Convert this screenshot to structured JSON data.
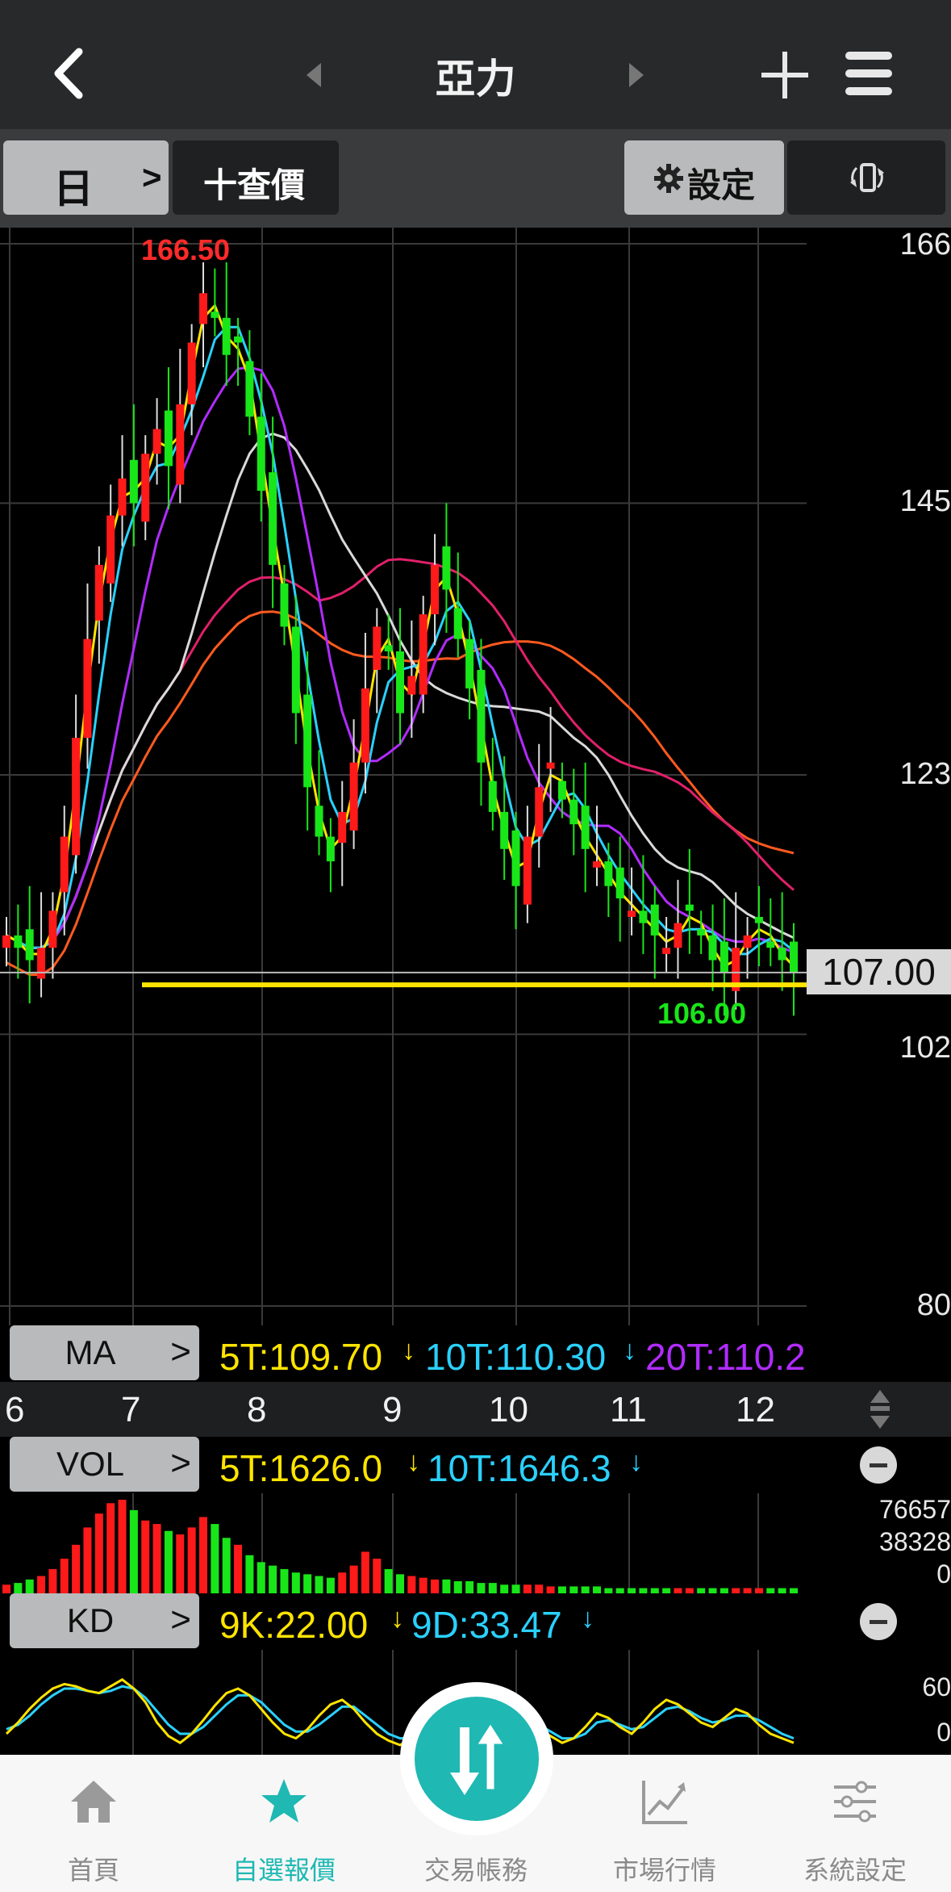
{
  "header": {
    "title": "亞力",
    "back_icon": "chevron-left-icon",
    "prev_icon": "triangle-left-icon",
    "next_icon": "triangle-right-icon",
    "add_icon": "plus-icon",
    "menu_icon": "hamburger-icon"
  },
  "toolbar": {
    "period": "日",
    "period_chevron": ">",
    "query": "十查價",
    "settings": "設定",
    "settings_icon": "gear-icon",
    "rotate_icon": "rotate-icon"
  },
  "colors": {
    "up": "#ff1a1a",
    "down": "#19e619",
    "ma5": "#ffe400",
    "ma10": "#2ad1ff",
    "ma20": "#b12cff",
    "ma60": "#d9d9d9",
    "ma120": "#e0206a",
    "ma240": "#ff5a1f",
    "accent": "#1fb8b3"
  },
  "ma_panel": {
    "button": "MA",
    "chevron": ">",
    "v5": "5T:109.70",
    "v10": "10T:110.30",
    "v20": "20T:110.2",
    "arrow": "↓"
  },
  "vol_panel": {
    "button": "VOL",
    "chevron": ">",
    "v5": "5T:1626.0",
    "v10": "10T:1646.3",
    "arrow": "↓"
  },
  "kd_panel": {
    "button": "KD",
    "chevron": ">",
    "v9k": "9K:22.00",
    "v9d": "9D:33.47",
    "arrow": "↓"
  },
  "chart_data": {
    "type": "candlestick",
    "title": "亞力",
    "price_axis_ticks": [
      "166",
      "145",
      "123",
      "102",
      "80"
    ],
    "ylim": [
      80,
      166
    ],
    "high_label": "166.50",
    "low_label": "106.00",
    "last_price": "107.00",
    "support_line": 106,
    "x_ticks": [
      "6",
      "7",
      "8",
      "9",
      "10",
      "11",
      "12"
    ],
    "close_series": [
      110,
      109,
      108,
      109,
      112,
      118,
      126,
      134,
      140,
      144,
      147,
      145,
      149,
      151,
      148,
      153,
      158,
      162,
      160,
      157,
      158,
      152,
      146,
      140,
      135,
      128,
      122,
      118,
      116,
      120,
      124,
      130,
      135,
      133,
      128,
      131,
      136,
      140,
      138,
      134,
      130,
      124,
      120,
      117,
      114,
      118,
      122,
      124,
      121,
      119,
      117,
      116,
      114,
      113,
      112,
      111,
      110,
      109,
      111,
      112,
      110,
      108,
      107,
      109,
      110,
      111,
      109,
      108,
      107
    ],
    "volume_axis": [
      "76657",
      "38328",
      "0"
    ],
    "volume": [
      5,
      6,
      8,
      10,
      14,
      20,
      28,
      38,
      46,
      52,
      54,
      48,
      42,
      40,
      36,
      34,
      38,
      44,
      40,
      32,
      28,
      22,
      18,
      16,
      14,
      12,
      11,
      10,
      9,
      12,
      16,
      24,
      20,
      14,
      11,
      10,
      9,
      8,
      8,
      7,
      7,
      6,
      6,
      5,
      5,
      5,
      5,
      4,
      4,
      4,
      4,
      4,
      3,
      3,
      3,
      3,
      3,
      3,
      3,
      3,
      3,
      3,
      3,
      3,
      3,
      3,
      3,
      3,
      3
    ],
    "kd_axis": [
      "60",
      "0"
    ],
    "k_series": [
      30,
      40,
      52,
      62,
      70,
      74,
      72,
      68,
      66,
      72,
      78,
      70,
      58,
      40,
      28,
      22,
      30,
      42,
      55,
      66,
      70,
      64,
      52,
      40,
      30,
      26,
      34,
      46,
      56,
      60,
      52,
      40,
      30,
      24,
      20,
      26,
      34,
      44,
      38,
      30,
      24,
      22,
      30,
      40,
      46,
      42,
      34,
      28,
      22,
      26,
      36,
      48,
      44,
      36,
      30,
      40,
      52,
      60,
      56,
      48,
      40,
      36,
      44,
      52,
      48,
      38,
      30,
      26,
      22
    ],
    "d_series": [
      34,
      38,
      46,
      56,
      64,
      70,
      70,
      68,
      66,
      68,
      72,
      70,
      62,
      50,
      38,
      30,
      30,
      36,
      46,
      56,
      64,
      64,
      58,
      48,
      38,
      32,
      32,
      38,
      46,
      54,
      54,
      46,
      38,
      30,
      26,
      26,
      30,
      38,
      38,
      34,
      28,
      26,
      28,
      34,
      40,
      42,
      38,
      32,
      26,
      26,
      30,
      40,
      42,
      38,
      34,
      36,
      44,
      52,
      54,
      50,
      44,
      40,
      42,
      46,
      46,
      42,
      36,
      30,
      26
    ]
  },
  "tabs": [
    {
      "label": "首頁",
      "icon": "home-icon"
    },
    {
      "label": "自選報價",
      "icon": "star-icon"
    },
    {
      "label": "交易帳務",
      "icon": "trade-arrows-icon"
    },
    {
      "label": "市場行情",
      "icon": "chart-line-icon"
    },
    {
      "label": "系統設定",
      "icon": "sliders-icon"
    }
  ]
}
